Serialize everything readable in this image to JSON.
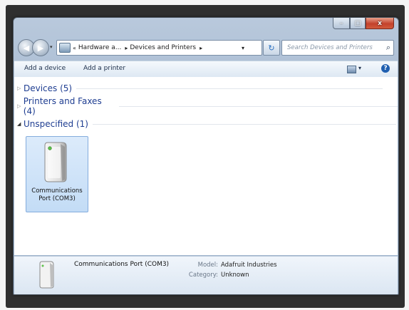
{
  "window": {
    "caption": {
      "minimize": "–",
      "maximize": "□",
      "close": "x"
    }
  },
  "nav": {
    "address": {
      "prefix": "«",
      "crumbs": [
        "Hardware a...",
        "Devices and Printers"
      ],
      "separator": "▸",
      "dropdown": "▾"
    },
    "refresh": "↻",
    "search_placeholder": "Search Devices and Printers"
  },
  "toolbar": {
    "add_device": "Add a device",
    "add_printer": "Add a printer",
    "view_drop": "▾",
    "help": "?"
  },
  "groups": [
    {
      "label": "Devices (5)",
      "expanded": false
    },
    {
      "label": "Printers and Faxes (4)",
      "expanded": false
    },
    {
      "label": "Unspecified (1)",
      "expanded": true
    }
  ],
  "tile": {
    "label": "Communications Port (COM3)"
  },
  "details": {
    "name": "Communications Port (COM3)",
    "model_label": "Model:",
    "model_value": "Adafruit Industries",
    "category_label": "Category:",
    "category_value": "Unknown"
  },
  "colors": {
    "group_text": "#1e3d91",
    "close_button": "#c4422c",
    "tile_selected": "#c3dcf6"
  }
}
